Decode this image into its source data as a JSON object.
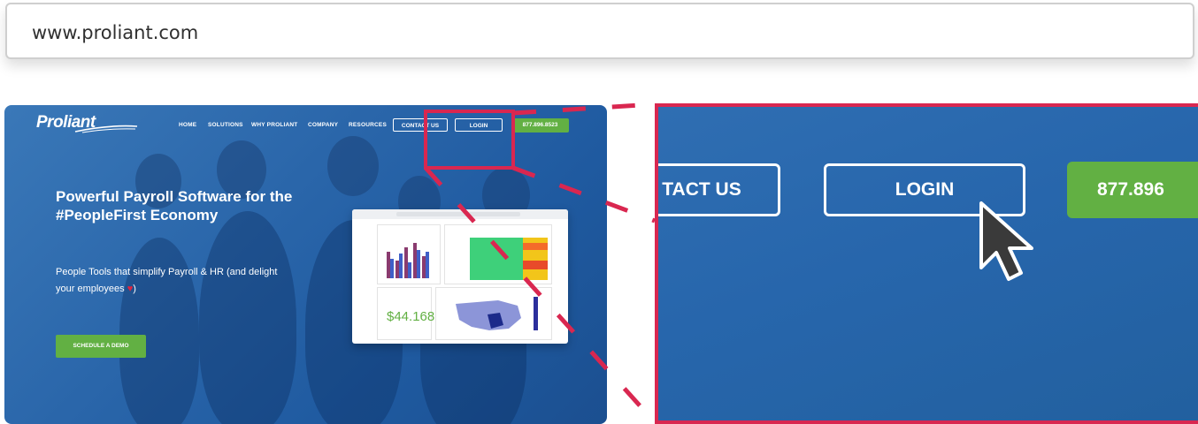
{
  "browser": {
    "url": "www.proliant.com"
  },
  "site": {
    "logo": "Proliant",
    "nav": {
      "items": [
        "HOME",
        "SOLUTIONS",
        "WHY PROLIANT",
        "COMPANY",
        "RESOURCES"
      ],
      "contact_label": "CONTACT US",
      "login_label": "LOGIN",
      "phone": "877.896.8523"
    },
    "hero": {
      "title": "Powerful Payroll Software for the #PeopleFirst Economy",
      "subtitle": "People Tools that simplify Payroll & HR (and delight your employees",
      "subtitle_end": ")",
      "cta_label": "SCHEDULE A DEMO"
    },
    "dashboard": {
      "amount": "$44.168"
    }
  },
  "zoom": {
    "contact_label": "TACT US",
    "login_label": "LOGIN",
    "phone": "877.896"
  },
  "colors": {
    "highlight": "#d92750",
    "site_blue": "#2766ac",
    "green": "#62b043"
  },
  "icons": {
    "cursor": "mouse-pointer-icon",
    "heart": "heart-icon"
  }
}
